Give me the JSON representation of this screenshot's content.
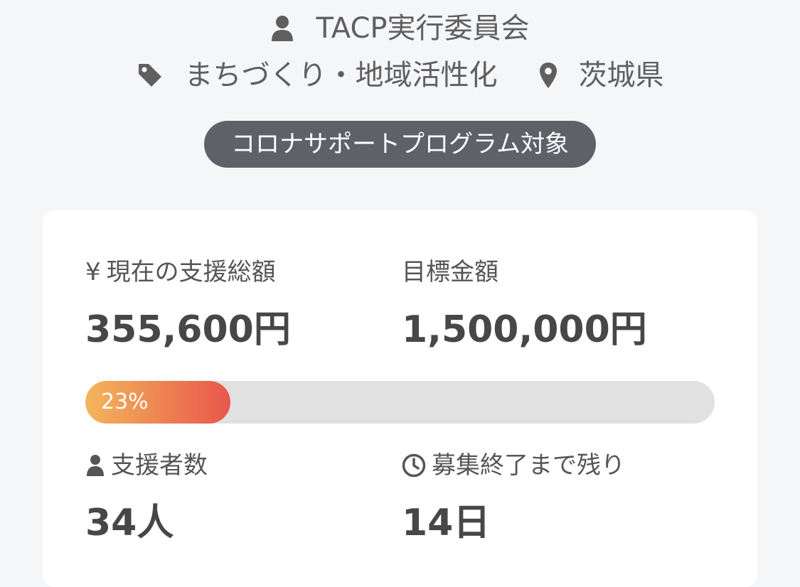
{
  "project": {
    "owner": "TACP実行委員会",
    "owner_icon": "user-icon",
    "category": "まちづくり・地域活性化",
    "category_icon": "tag-icon",
    "location": "茨城県",
    "location_icon": "map-pin-icon",
    "badge": "コロナサポートプログラム対象"
  },
  "stats": {
    "current_total": {
      "icon": "yen-icon",
      "icon_glyph": "¥",
      "label": "現在の支援総額",
      "value": "355,600円"
    },
    "target_amount": {
      "label": "目標金額",
      "value": "1,500,000円"
    },
    "supporters": {
      "icon": "user-icon",
      "label": "支援者数",
      "value": "34人"
    },
    "remaining": {
      "icon": "clock-icon",
      "label": "募集終了まで残り",
      "value": "14日"
    }
  },
  "progress": {
    "percent": 23,
    "label": "23%"
  },
  "colors": {
    "background": "#f5f6f8",
    "badge": "#5e6168",
    "progress_track": "#e1e1e1",
    "progress_start": "#f3b65c",
    "progress_end": "#e9564d",
    "text": "#555555"
  }
}
